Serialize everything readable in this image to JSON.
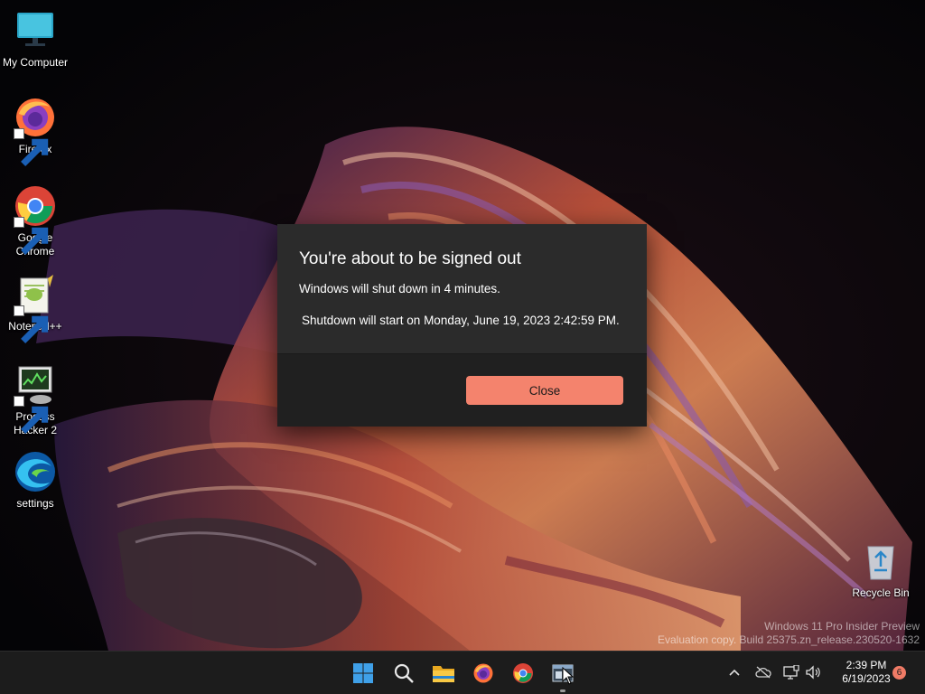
{
  "desktop": {
    "icons": [
      {
        "label": "My Computer",
        "icon": "monitor-icon"
      },
      {
        "label": "Firefox",
        "icon": "firefox-icon"
      },
      {
        "label": "Google Chrome",
        "icon": "chrome-icon"
      },
      {
        "label": "Notepad++",
        "icon": "notepad-plus-plus-icon"
      },
      {
        "label": "Process Hacker 2",
        "icon": "process-hacker-icon"
      },
      {
        "label": "settings",
        "icon": "edge-icon"
      }
    ],
    "recycle_bin": {
      "label": "Recycle Bin",
      "icon": "recycle-bin-icon"
    }
  },
  "dialog": {
    "title": "You're about to be signed out",
    "message": "Windows will shut down in 4 minutes.",
    "detail": "Shutdown will start on Monday, June 19, 2023 2:42:59 PM.",
    "close_label": "Close",
    "accent": "#f4836d"
  },
  "watermark": {
    "line1": "Windows 11 Pro Insider Preview",
    "line2": "Evaluation copy. Build 25375.zn_release.230520-1632"
  },
  "taskbar": {
    "items": [
      {
        "icon": "windows-start-icon"
      },
      {
        "icon": "search-icon"
      },
      {
        "icon": "file-explorer-icon"
      },
      {
        "icon": "firefox-icon"
      },
      {
        "icon": "chrome-icon"
      },
      {
        "icon": "app-window-icon",
        "active": true
      }
    ],
    "tray": [
      {
        "icon": "chevron-up-icon"
      },
      {
        "icon": "cloud-offline-icon"
      },
      {
        "icon": "network-icon"
      },
      {
        "icon": "volume-icon"
      }
    ],
    "clock": {
      "time": "2:39 PM",
      "date": "6/19/2023"
    },
    "notification_count": "6"
  }
}
